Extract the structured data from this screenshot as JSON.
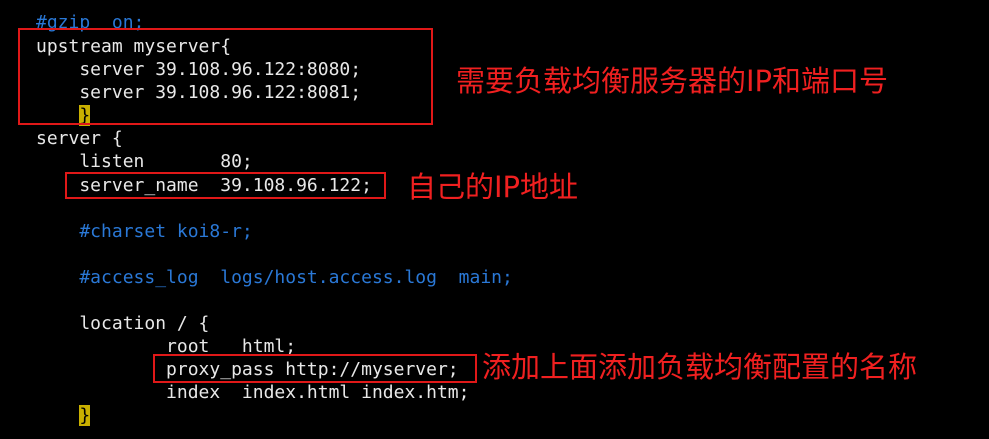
{
  "code_lines": {
    "l00": "#gzip  on;",
    "l01": "upstream myserver{",
    "l02": "    server 39.108.96.122:8080;",
    "l03": "    server 39.108.96.122:8081;",
    "l04_indent": "    ",
    "l04_brace": "}",
    "l05": "server {",
    "l06": "    listen       80;",
    "l07": "    server_name  39.108.96.122;",
    "l09": "    #charset koi8-r;",
    "l11": "    #access_log  logs/host.access.log  main;",
    "l13": "    location / {",
    "l14": "            root   html;",
    "l15": "            proxy_pass http://myserver;",
    "l16": "            index  index.html index.htm;",
    "l17_indent": "    ",
    "l17_brace": "}"
  },
  "annotations": {
    "upstream_note": "需要负载均衡服务器的IP和端口号",
    "server_name_note": "自己的IP地址",
    "proxy_pass_note": "添加上面添加负载均衡配置的名称"
  },
  "colors": {
    "background": "#000000",
    "text": "#e8e8e8",
    "comment": "#2a78d6",
    "annotation": "#f02020",
    "cursor": "#c9b000"
  }
}
